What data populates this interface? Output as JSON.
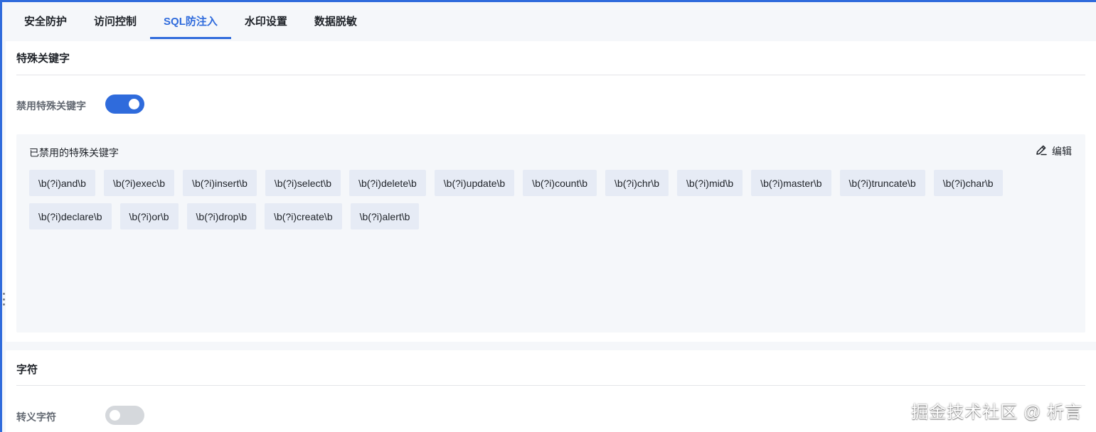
{
  "tabs": [
    {
      "label": "安全防护",
      "active": false
    },
    {
      "label": "访问控制",
      "active": false
    },
    {
      "label": "SQL防注入",
      "active": true
    },
    {
      "label": "水印设置",
      "active": false
    },
    {
      "label": "数据脱敏",
      "active": false
    }
  ],
  "keywords_section": {
    "title": "特殊关键字",
    "toggle_label": "禁用特殊关键字",
    "toggle_on": true,
    "list_label": "已禁用的特殊关键字",
    "edit_label": "编辑",
    "edit_icon": "pencil-icon",
    "tags": [
      "\\b(?i)and\\b",
      "\\b(?i)exec\\b",
      "\\b(?i)insert\\b",
      "\\b(?i)select\\b",
      "\\b(?i)delete\\b",
      "\\b(?i)update\\b",
      "\\b(?i)count\\b",
      "\\b(?i)chr\\b",
      "\\b(?i)mid\\b",
      "\\b(?i)master\\b",
      "\\b(?i)truncate\\b",
      "\\b(?i)char\\b",
      "\\b(?i)declare\\b",
      "\\b(?i)or\\b",
      "\\b(?i)drop\\b",
      "\\b(?i)create\\b",
      "\\b(?i)alert\\b"
    ]
  },
  "characters_section": {
    "title": "字符",
    "toggle_label": "转义字符",
    "toggle_on": false
  },
  "watermark": "掘金技术社区 @ 析言",
  "colors": {
    "accent": "#2f6bdc",
    "tag_bg": "#e6ebf5",
    "switch_off": "#d5d8dc"
  }
}
